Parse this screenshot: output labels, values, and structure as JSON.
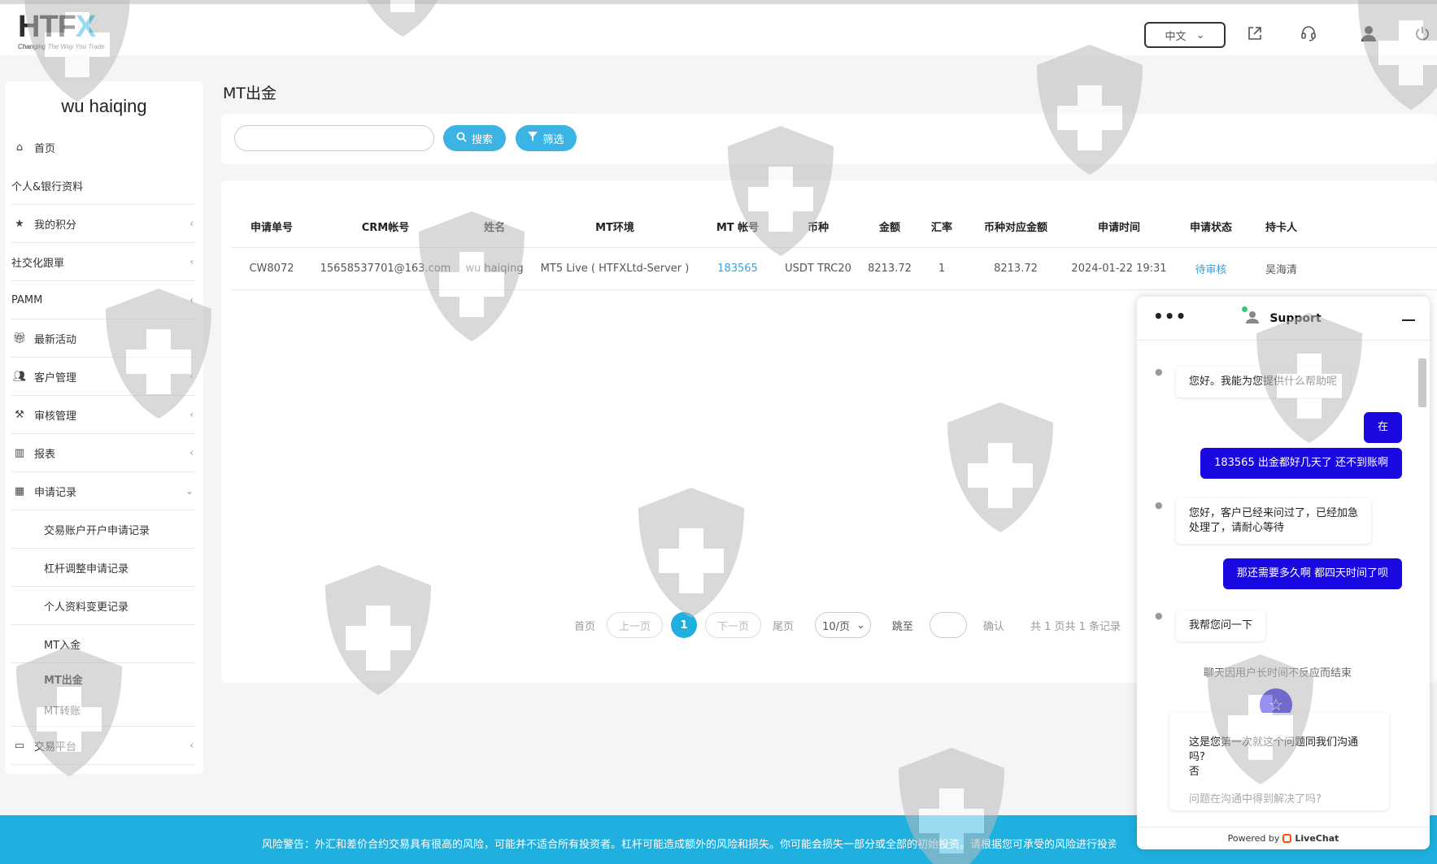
{
  "header": {
    "logo_brand": "HTF",
    "logo_brand_x": "X",
    "logo_tagline": "Changing The Way You Trade",
    "language": "中文",
    "icons": [
      "external-link-icon",
      "headset-icon",
      "user-icon",
      "power-icon"
    ]
  },
  "sidebar": {
    "user_name": "wu haiqing",
    "items": [
      {
        "label": "首页",
        "icon": "home-icon"
      },
      {
        "label": "个人&银行资料"
      },
      {
        "label": "我的积分",
        "icon": "star-icon"
      },
      {
        "label": "社交化跟單"
      },
      {
        "label": "PAMM"
      },
      {
        "label": "最新活动",
        "icon": "gift-icon"
      },
      {
        "label": "客户管理",
        "icon": "users-icon"
      },
      {
        "label": "审核管理",
        "icon": "gavel-icon"
      },
      {
        "label": "报表",
        "icon": "chart-icon"
      },
      {
        "label": "申请记录",
        "icon": "calendar-icon"
      }
    ],
    "sub_items": [
      "交易账户开户申请记录",
      "杠杆调整申请记录",
      "个人资料变更记录",
      "MT入金",
      "MT出金",
      "MT转账"
    ],
    "last_item": {
      "label": "交易平台",
      "icon": "monitor-icon"
    }
  },
  "main": {
    "page_title": "MT出金",
    "search_placeholder": "",
    "search_button": "搜索",
    "filter_button": "筛选",
    "table": {
      "headers": [
        "申请单号",
        "CRM帐号",
        "姓名",
        "MT环境",
        "MT 帐号",
        "币种",
        "金额",
        "汇率",
        "币种对应金额",
        "申请时间",
        "申请状态",
        "持卡人"
      ],
      "rows": [
        [
          "CW8072",
          "15658537701@163.com",
          "wu haiqing",
          "MT5 Live ( HTFXLtd-Server )",
          "183565",
          "USDT TRC20",
          "8213.72",
          "1",
          "8213.72",
          "2024-01-22 19:31",
          "待审核",
          "吴海清"
        ]
      ]
    },
    "pagination": {
      "first": "首页",
      "prev": "上一页",
      "current": "1",
      "next": "下一页",
      "last": "尾页",
      "page_size": "10/页",
      "jump_label": "跳至",
      "confirm": "确认",
      "summary": "共 1 页共 1 条记录"
    }
  },
  "footer": {
    "risk_warning": "风险警告：外汇和差价合约交易具有很高的风险，可能并不适合所有投资者。杠杆可能造成额外的风险和损失。你可能会损失一部分或全部的初始投资。请根据您可承受的风险进行投资。在"
  },
  "chat": {
    "title": "Support",
    "messages": [
      {
        "from": "agent",
        "text": "您好。我能为您提供什么帮助呢"
      },
      {
        "from": "user",
        "text": "在"
      },
      {
        "from": "user",
        "text": "183565 出金都好几天了 还不到账啊"
      },
      {
        "from": "agent",
        "text": "您好，客户已经来问过了，已经加急处理了，请耐心等待"
      },
      {
        "from": "user",
        "text": "那还需要多久啊 都四天时间了呗"
      },
      {
        "from": "agent",
        "text": "我帮您问一下"
      }
    ],
    "system_note": "聊天因用户长时间不反应而结束",
    "survey_question": "这是您第一次就这个问题同我们沟通吗?",
    "survey_answer": "否",
    "survey_next": "问题在沟通中得到解决了吗?",
    "powered_by": "Powered by",
    "powered_brand": "LiveChat"
  },
  "colors": {
    "accent": "#1fb0e0",
    "button": "#3bb4e5",
    "chat_user_bubble": "#1a08e0",
    "link": "#3ba0d8"
  }
}
